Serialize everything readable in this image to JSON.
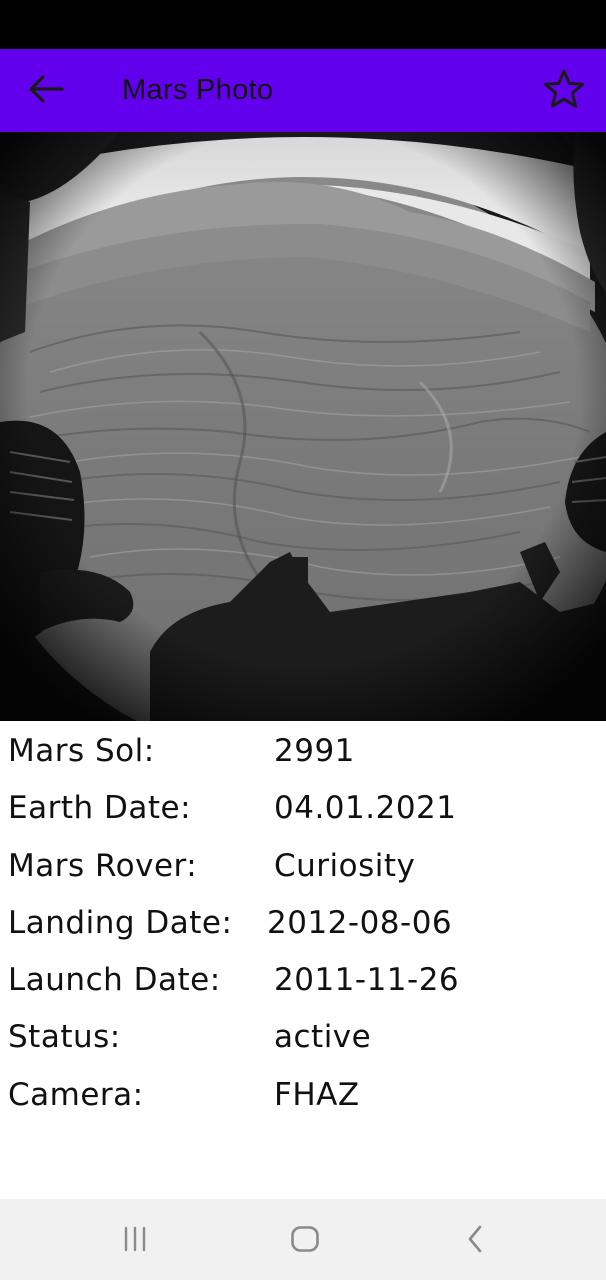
{
  "app_bar": {
    "title": "Mars Photo",
    "color": "#6200EE",
    "back_icon": "arrow-left-icon",
    "favorite_icon": "star-outline-icon"
  },
  "photo": {
    "description_icon": "mars-surface-photo"
  },
  "details": [
    {
      "label": "Mars Sol:",
      "value": "2991"
    },
    {
      "label": "Earth Date:",
      "value": "04.01.2021"
    },
    {
      "label": "Mars Rover:",
      "value": "Curiosity"
    },
    {
      "label": "Landing Date:",
      "value": "2012-08-06"
    },
    {
      "label": "Launch Date:",
      "value": "2011-11-26"
    },
    {
      "label": "Status:",
      "value": "active"
    },
    {
      "label": "Camera:",
      "value": "FHAZ"
    }
  ],
  "nav_bar": {
    "recents_icon": "recents-icon",
    "home_icon": "home-icon",
    "back_icon": "back-chevron-icon"
  }
}
